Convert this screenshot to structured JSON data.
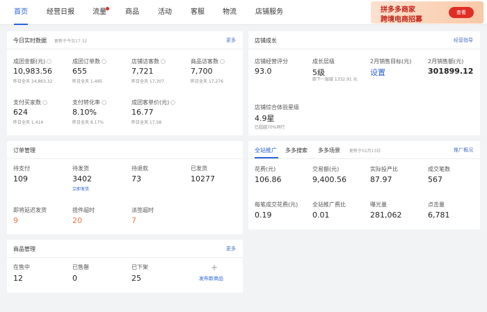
{
  "nav": {
    "items": [
      "首页",
      "经营日报",
      "流量",
      "商品",
      "活动",
      "客服",
      "物流",
      "店铺服务"
    ],
    "banner": {
      "line1": "拼多多商家",
      "line2": "跨境电商招募",
      "button": "查看"
    }
  },
  "realtime": {
    "title": "今日实时数据",
    "updated": "更新于今日17:32",
    "more": "更多",
    "metrics": [
      {
        "label": "成团金额(元)",
        "value": "10,983.56",
        "yday": "昨日全天 24,863.32"
      },
      {
        "label": "成团订单数",
        "value": "655",
        "yday": "昨日全天 1,495"
      },
      {
        "label": "店铺访客数",
        "value": "7,721",
        "yday": "昨日全天 17,307"
      },
      {
        "label": "商品访客数",
        "value": "7,700",
        "yday": "昨日全天 17,276"
      },
      {
        "label": "支付买家数",
        "value": "624",
        "yday": "昨日全天 1,414"
      },
      {
        "label": "支付转化率",
        "value": "8.10%",
        "yday": "昨日全天 8.17%"
      },
      {
        "label": "成团客单价(元)",
        "value": "16.77",
        "yday": "昨日全天 17.58"
      }
    ]
  },
  "growth": {
    "title": "店铺成长",
    "link": "经营指导",
    "score_label": "店铺经营评分",
    "score": "93.0",
    "level_label": "成长层级",
    "level": "5级",
    "level_note": "距下一层级 1332.91 元",
    "target_label": "2月销售目标(元)",
    "target": "设置",
    "sales_label": "2月销售额(元)",
    "sales": "301899.12",
    "exp_label": "店铺综合体验星级",
    "exp": "4.9星",
    "exp_note": "已超越70%同行"
  },
  "orders": {
    "title": "订单管理",
    "items": [
      {
        "label": "待支付",
        "value": "109"
      },
      {
        "label": "待发货",
        "value": "3402",
        "note": "立即发货"
      },
      {
        "label": "待退款",
        "value": "73"
      },
      {
        "label": "已发货",
        "value": "10277"
      },
      {
        "label": "即将延迟发货",
        "value": "9"
      },
      {
        "label": "揽件超时",
        "value": "20"
      },
      {
        "label": "派签超时",
        "value": "7"
      }
    ]
  },
  "promo": {
    "tabs": [
      "全站推广",
      "多多搜索",
      "多多场景"
    ],
    "updated": "更新于02月13日",
    "link": "推广概况",
    "metrics": [
      {
        "label": "花费(元)",
        "value": "106.86"
      },
      {
        "label": "交易额(元)",
        "value": "9,400.56"
      },
      {
        "label": "实际投产比",
        "value": "87.97"
      },
      {
        "label": "成交笔数",
        "value": "567"
      },
      {
        "label": "每笔成交花费(元)",
        "value": "0.19"
      },
      {
        "label": "全站推广费比",
        "value": "0.01"
      },
      {
        "label": "曝光量",
        "value": "281,062"
      },
      {
        "label": "点击量",
        "value": "6,781"
      }
    ]
  },
  "goods": {
    "title": "商品管理",
    "more": "更多",
    "items": [
      {
        "label": "在售中",
        "value": "12"
      },
      {
        "label": "已售罄",
        "value": "0"
      },
      {
        "label": "已下架",
        "value": "25"
      }
    ],
    "add_icon": "+",
    "add_label": "发布新商品"
  }
}
